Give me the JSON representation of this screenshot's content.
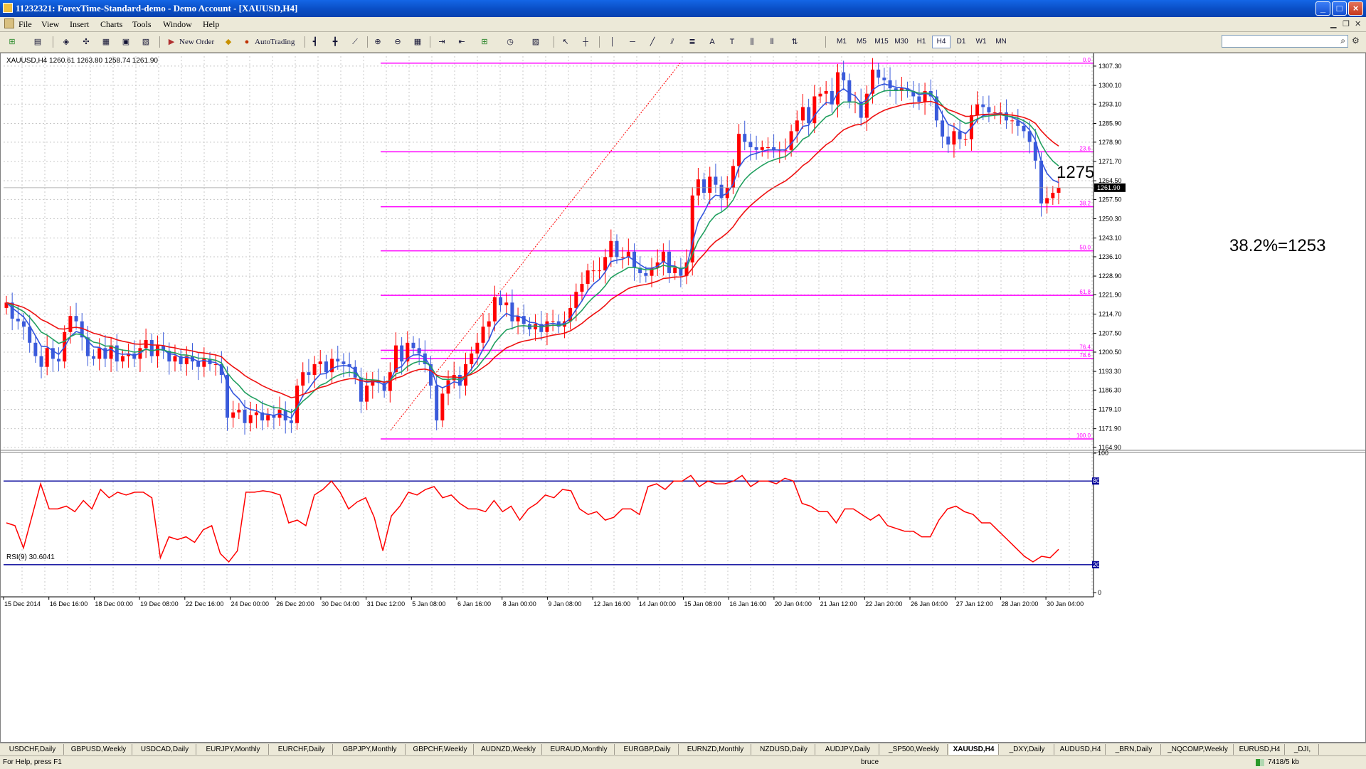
{
  "window": {
    "title": "11232321: ForexTime-Standard-demo - Demo Account - [XAUUSD,H4]",
    "minimize": "_",
    "maximize": "□",
    "close": "×"
  },
  "menu": [
    "File",
    "View",
    "Insert",
    "Charts",
    "Tools",
    "Window",
    "Help"
  ],
  "toolbar": {
    "new_order": "New Order",
    "auto_trading": "AutoTrading",
    "timeframes": [
      "M1",
      "M5",
      "M15",
      "M30",
      "H1",
      "H4",
      "D1",
      "W1",
      "MN"
    ],
    "active_timeframe": "H4"
  },
  "chart": {
    "header": "XAUUSD,H4  1260.61 1263.80 1258.74 1261.90",
    "current_price": "1261.90",
    "annotation_1275": "1275",
    "annotation_382": "38.2%=1253",
    "price_ticks": [
      "1307.30",
      "1300.10",
      "1293.10",
      "1285.90",
      "1278.90",
      "1271.70",
      "1264.50",
      "1257.50",
      "1250.30",
      "1243.10",
      "1236.10",
      "1228.90",
      "1221.90",
      "1214.70",
      "1207.50",
      "1200.50",
      "1193.30",
      "1186.30",
      "1179.10",
      "1171.90",
      "1164.90"
    ],
    "fib_levels": [
      {
        "label": "0.0",
        "price": 1308.4
      },
      {
        "label": "23.6",
        "price": 1275.3
      },
      {
        "label": "38.2",
        "price": 1254.8
      },
      {
        "label": "50.0",
        "price": 1238.3
      },
      {
        "label": "61.8",
        "price": 1221.7
      },
      {
        "label": "76.4",
        "price": 1201.2
      },
      {
        "label": "78.6",
        "price": 1198.1
      },
      {
        "label": "100.0",
        "price": 1168.1
      }
    ],
    "time_labels": [
      "15 Dec 2014",
      "16 Dec 16:00",
      "18 Dec 00:00",
      "19 Dec 08:00",
      "22 Dec 16:00",
      "24 Dec 00:00",
      "26 Dec 20:00",
      "30 Dec 04:00",
      "31 Dec 12:00",
      "5 Jan 08:00",
      "6 Jan 16:00",
      "8 Jan 00:00",
      "9 Jan 08:00",
      "12 Jan 16:00",
      "14 Jan 00:00",
      "15 Jan 08:00",
      "16 Jan 16:00",
      "20 Jan 04:00",
      "21 Jan 12:00",
      "22 Jan 20:00",
      "26 Jan 04:00",
      "27 Jan 12:00",
      "28 Jan 20:00",
      "30 Jan 04:00"
    ],
    "colors": {
      "bull": "#ff0000",
      "bear": "#3b5bdb",
      "fib": "#ff00ff",
      "ma_fast": "#3355dd",
      "ma_mid": "#22a060",
      "ma_slow": "#ee1111",
      "rsi": "#ff0000",
      "rsi_levels": "#000099"
    }
  },
  "rsi": {
    "header": "RSI(9) 30.6041",
    "ticks": [
      "100",
      "80",
      "20",
      "0"
    ]
  },
  "chart_data": {
    "type": "candlestick",
    "symbol": "XAUUSD",
    "timeframe": "H4",
    "ylim": [
      1164.9,
      1311.0
    ],
    "closes": [
      1219,
      1213,
      1212,
      1210,
      1204,
      1199,
      1195,
      1202,
      1198,
      1197,
      1208,
      1214,
      1212,
      1206,
      1199,
      1198,
      1202,
      1198,
      1203,
      1197,
      1199,
      1200,
      1198,
      1202,
      1205,
      1199,
      1203,
      1201,
      1197,
      1199,
      1196,
      1199,
      1197,
      1195,
      1198,
      1196,
      1196,
      1192,
      1176,
      1178,
      1179,
      1174,
      1177,
      1178,
      1175,
      1177,
      1176,
      1179,
      1175,
      1174,
      1188,
      1193,
      1192,
      1196,
      1197,
      1193,
      1198,
      1197,
      1196,
      1195,
      1191,
      1182,
      1188,
      1190,
      1189,
      1186,
      1193,
      1203,
      1197,
      1204,
      1202,
      1200,
      1196,
      1188,
      1175,
      1185,
      1190,
      1192,
      1188,
      1196,
      1200,
      1204,
      1210,
      1212,
      1221,
      1218,
      1219,
      1212,
      1214,
      1211,
      1209,
      1211,
      1208,
      1212,
      1212,
      1210,
      1212,
      1217,
      1223,
      1226,
      1231,
      1231,
      1231,
      1236,
      1242,
      1236,
      1236,
      1238,
      1232,
      1230,
      1229,
      1232,
      1234,
      1238,
      1230,
      1232,
      1229,
      1234,
      1259,
      1265,
      1260,
      1266,
      1263,
      1258,
      1262,
      1270,
      1282,
      1279,
      1277,
      1276,
      1277,
      1277,
      1276,
      1276,
      1276,
      1283,
      1287,
      1292,
      1286,
      1296,
      1297,
      1298,
      1293,
      1305,
      1302,
      1294,
      1294,
      1288,
      1297,
      1306,
      1303,
      1302,
      1299,
      1298,
      1299,
      1298,
      1296,
      1294,
      1298,
      1296,
      1287,
      1281,
      1278,
      1283,
      1280,
      1280,
      1289,
      1293,
      1292,
      1290,
      1290,
      1290,
      1287,
      1287,
      1285,
      1283,
      1279,
      1272,
      1256,
      1258,
      1260,
      1261.9
    ],
    "rsi_values": [
      50,
      48,
      32,
      55,
      78,
      60,
      60,
      62,
      58,
      66,
      60,
      74,
      68,
      72,
      70,
      72,
      72,
      68,
      25,
      40,
      38,
      40,
      36,
      45,
      48,
      28,
      22,
      30,
      72,
      72,
      73,
      72,
      70,
      50,
      52,
      48,
      70,
      74,
      80,
      72,
      60,
      65,
      68,
      54,
      30,
      55,
      62,
      72,
      70,
      74,
      76,
      68,
      70,
      64,
      60,
      60,
      58,
      66,
      58,
      62,
      52,
      60,
      64,
      70,
      68,
      74,
      73,
      60,
      56,
      58,
      52,
      54,
      60,
      60,
      56,
      76,
      78,
      74,
      80,
      80,
      84,
      76,
      80,
      78,
      78,
      80,
      84,
      76,
      80,
      80,
      78,
      82,
      80,
      64,
      62,
      58,
      58,
      50,
      60,
      60,
      56,
      52,
      56,
      48,
      46,
      44,
      44,
      40,
      40,
      52,
      60,
      62,
      58,
      56,
      50,
      50,
      44,
      38,
      32,
      26,
      22,
      26,
      25,
      31
    ],
    "moving_averages": [
      "fast (blue)",
      "mid (green)",
      "slow (red)"
    ]
  },
  "symbol_tabs": [
    "USDCHF,Daily",
    "GBPUSD,Weekly",
    "USDCAD,Daily",
    "EURJPY,Monthly",
    "EURCHF,Daily",
    "GBPJPY,Monthly",
    "GBPCHF,Weekly",
    "AUDNZD,Weekly",
    "EURAUD,Monthly",
    "EURGBP,Daily",
    "EURNZD,Monthly",
    "NZDUSD,Daily",
    "AUDJPY,Daily",
    "_SP500,Weekly",
    "XAUUSD,H4",
    "_DXY,Daily",
    "AUDUSD,H4",
    "_BRN,Daily",
    "_NQCOMP,Weekly",
    "EURUSD,H4",
    "_DJI,"
  ],
  "active_tab": "XAUUSD,H4",
  "status": {
    "help": "For Help, press F1",
    "profile": "bruce",
    "traffic": "7418/5 kb"
  }
}
